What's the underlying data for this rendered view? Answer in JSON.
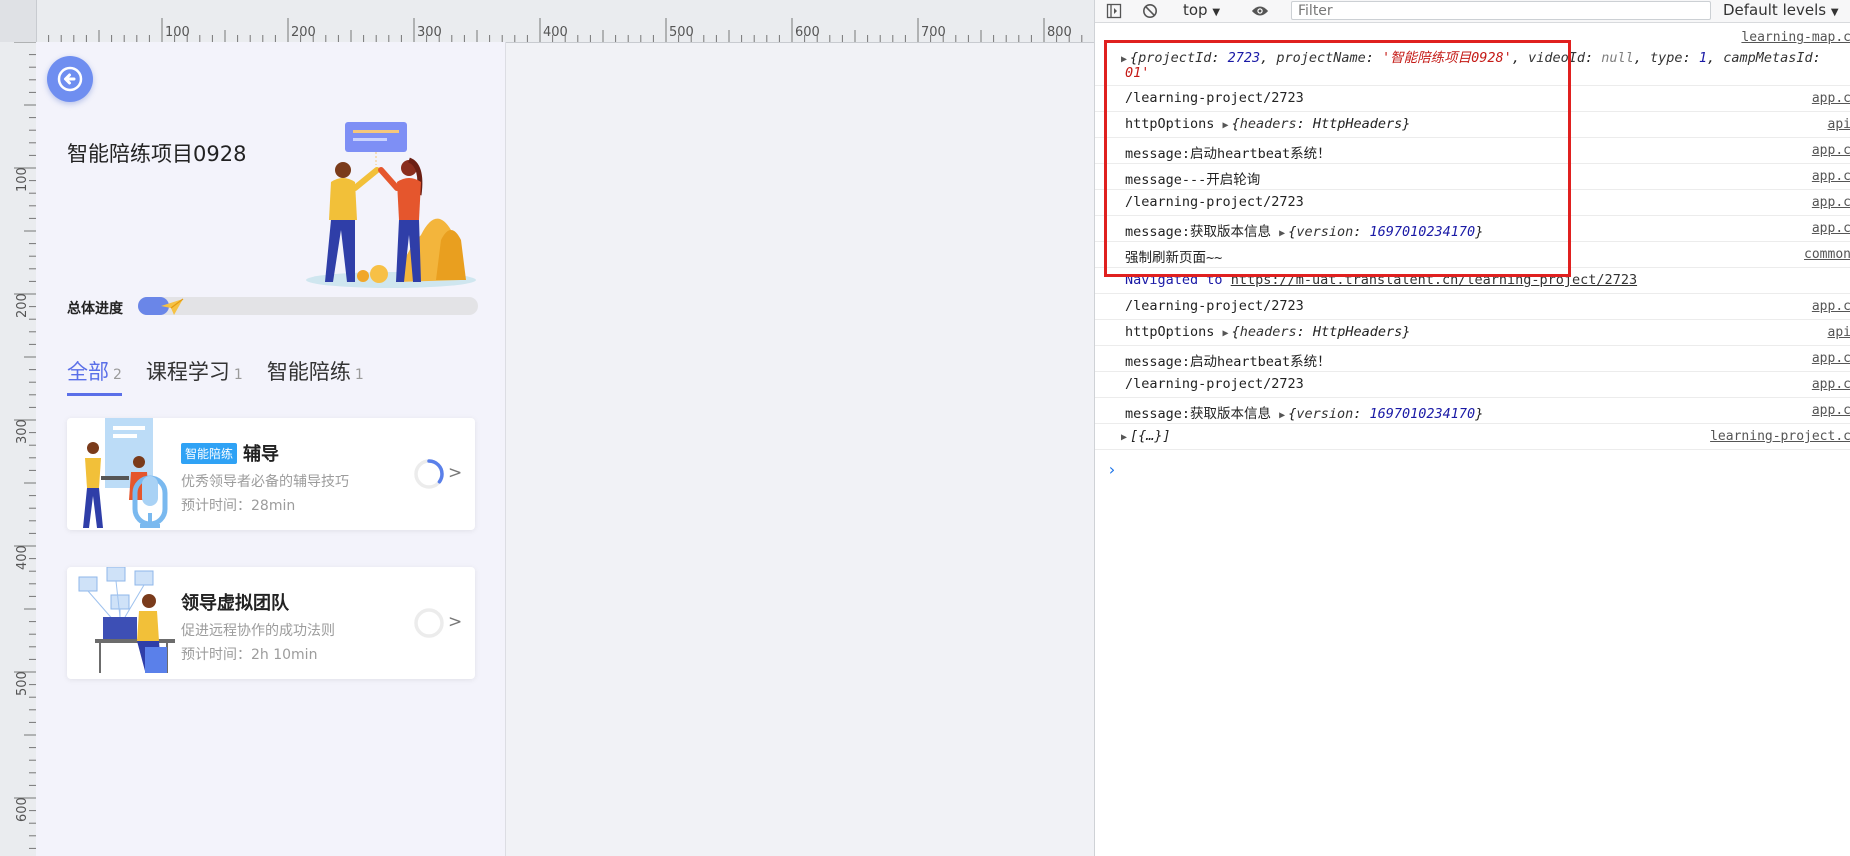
{
  "ruler": {
    "top_labels": [
      "100",
      "200",
      "300",
      "400",
      "500",
      "600",
      "700",
      "800"
    ],
    "left_labels": [
      "100",
      "200",
      "300",
      "400",
      "500",
      "600"
    ]
  },
  "app": {
    "title": "智能陪练项目0928",
    "progress_label": "总体进度",
    "progress_fraction": 0.09,
    "tabs": [
      {
        "label": "全部",
        "count": "2",
        "active": true
      },
      {
        "label": "课程学习",
        "count": "1",
        "active": false
      },
      {
        "label": "智能陪练",
        "count": "1",
        "active": false
      }
    ],
    "cards": [
      {
        "badge": "智能陪练",
        "title": "辅导",
        "subtitle": "优秀领导者必备的辅导技巧",
        "time": "预计时间：28min",
        "progress": 0.35
      },
      {
        "badge": "",
        "title": "领导虚拟团队",
        "subtitle": "促进远程协作的成功法则",
        "time": "预计时间：2h 10min",
        "progress": 0
      }
    ],
    "chevron": ">"
  },
  "devtools": {
    "context": "top",
    "filter_placeholder": "Filter",
    "levels": "Default levels",
    "top_source": "learning-map.c",
    "rows": {
      "r1": {
        "p1": "{",
        "k1": "projectId",
        "c1": ": ",
        "v1": "2723",
        "s1": ", ",
        "k2": "projectName",
        "c2": ": ",
        "v2": "'智能陪练项目0928'",
        "s2": ", ",
        "k3": "videoId",
        "c3": ": ",
        "v3": "null",
        "s3": ", ",
        "k4": "type",
        "c4": ": ",
        "v4": "1",
        "s4": ", ",
        "k5": "campMetasId",
        "c5": ":",
        "line2": "01'"
      },
      "r2": {
        "text": "/learning-project/2723",
        "src": "app.c"
      },
      "r3": {
        "text": "httpOptions",
        "obj_key": "headers",
        "obj_sep": ": ",
        "obj_val": "HttpHeaders",
        "open": "{",
        "close": "}",
        "src": "api"
      },
      "r4": {
        "text": "message:启动heartbeat系统！",
        "src": "app.c"
      },
      "r5": {
        "text": "message---开启轮询",
        "src": "app.c"
      },
      "r6": {
        "text": "/learning-project/2723",
        "src": "app.c"
      },
      "r7": {
        "text": "message:获取版本信息",
        "obj_key": "version",
        "obj_sep": ": ",
        "obj_val": "1697010234170",
        "open": "{",
        "close": "}",
        "src": "app.c"
      },
      "r8": {
        "text": "强制刷新页面~~",
        "src": "common"
      },
      "r9": {
        "text": "Navigated to",
        "url": "https://m-uat.translalent.cn/learning-project/2723"
      },
      "r10": {
        "text": "/learning-project/2723",
        "src": "app.c"
      },
      "r11": {
        "text": "httpOptions",
        "obj_key": "headers",
        "obj_sep": ": ",
        "obj_val": "HttpHeaders",
        "open": "{",
        "close": "}",
        "src": "api"
      },
      "r12": {
        "text": "message:启动heartbeat系统！",
        "src": "app.c"
      },
      "r13": {
        "text": "/learning-project/2723",
        "src": "app.c"
      },
      "r14": {
        "text": "message:获取版本信息",
        "obj_key": "version",
        "obj_sep": ": ",
        "obj_val": "1697010234170",
        "open": "{",
        "close": "}",
        "src": "app.c"
      },
      "r15": {
        "text": "[{…}]",
        "src": "learning-project.c"
      }
    },
    "prompt": "›"
  },
  "colors": {
    "accent": "#5a6fe8",
    "badge": "#2fa2f5",
    "highlight": "#e0201f"
  }
}
